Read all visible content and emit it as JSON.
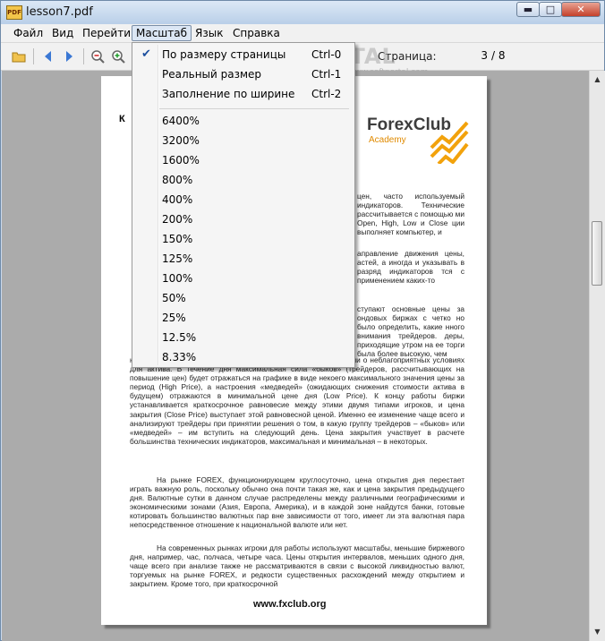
{
  "window": {
    "title": "lesson7.pdf",
    "app_icon": "PDF"
  },
  "menubar": {
    "items": [
      "Файл",
      "Вид",
      "Перейти",
      "Масштаб",
      "Язык",
      "Справка"
    ],
    "active_index": 3
  },
  "toolbar": {
    "icons": [
      "open-folder-icon",
      "back-arrow-icon",
      "forward-arrow-icon",
      "zoom-out-icon",
      "zoom-in-icon"
    ],
    "page_label": "Страница:",
    "current_page": "3",
    "page_total": "/ 8"
  },
  "watermark": {
    "text": "PORTAL",
    "sub": "www.softportal.com"
  },
  "zoom_menu": {
    "fit_items": [
      {
        "label": "По размеру страницы",
        "shortcut": "Ctrl-0",
        "checked": true
      },
      {
        "label": "Реальный размер",
        "shortcut": "Ctrl-1",
        "checked": false
      },
      {
        "label": "Заполнение по ширине",
        "shortcut": "Ctrl-2",
        "checked": false
      }
    ],
    "zoom_levels": [
      "6400%",
      "3200%",
      "1600%",
      "800%",
      "400%",
      "200%",
      "150%",
      "125%",
      "100%",
      "50%",
      "25%",
      "12.5%",
      "8.33%"
    ]
  },
  "document": {
    "logo_text": "ForexClub",
    "logo_sub": "Academy",
    "brand_colors": {
      "logo_text": "#3d3d3d",
      "stripes": "#f2a20c"
    },
    "lead_letter": "К",
    "right_col_1": "цен, часто используемый индикаторов. Технические рассчитывается с помощью ми Open, High, Low и Close ции выполняет компьютер, и",
    "right_col_2": "аправление движения цены, астей, а иногда и указывать в разряд индикаторов тся с применением каких-то",
    "right_col_3": "ступают основные цены за ондовых биржах с четко но было определить, какие нного внимания трейдеров. деры, приходящие утром на ее торги была более высокую, чем",
    "para_1": "наоборот, более низкую цену – в силу появившейся информации о неблагоприятных условиях для актива. В течение дня максимальная сила «быков» (трейдеров, рассчитывающих на повышение цен) будет отражаться на графике в виде некоего максимального значения цены за период (High Price), а настроения «медведей» (ожидающих снижения стоимости актива в будущем) отражаются в минимальной цене дня (Low Price). К концу работы биржи устанавливается краткосрочное равновесие между этими двумя типами игроков, и цена закрытия (Close Price) выступает этой равновесной ценой. Именно ее изменение чаще всего и анализируют трейдеры при принятии решения о том, в какую группу трейдеров – «быков» или «медведей» – им вступить на следующий день. Цена закрытия участвует в расчете большинства технических индикаторов, максимальная и минимальная – в некоторых.",
    "para_2": "На рынке FOREX, функционирующем круглосуточно, цена открытия дня перестает играть важную роль, поскольку обычно она почти такая же, как и цена закрытия предыдущего дня. Валютные сутки в данном случае распределены между различными географическими и экономическими зонами (Азия, Европа, Америка), и в каждой зоне найдутся банки, готовые котировать большинство валютных пар вне зависимости от того, имеет ли эта валютная пара непосредственное отношение к национальной валюте или нет.",
    "para_3": "На современных рынках игроки для работы используют масштабы, меньшие биржевого дня, например, час, полчаса, четыре часа. Цены открытия интервалов, меньших одного дня, чаще всего при анализе также не рассматриваются в связи с высокой ликвидностью валют, торгуемых на рынке FOREX, и редкости существенных расхождений между открытием и закрытием. Кроме того, при краткосрочной",
    "footer_url": "www.fxclub.org"
  }
}
